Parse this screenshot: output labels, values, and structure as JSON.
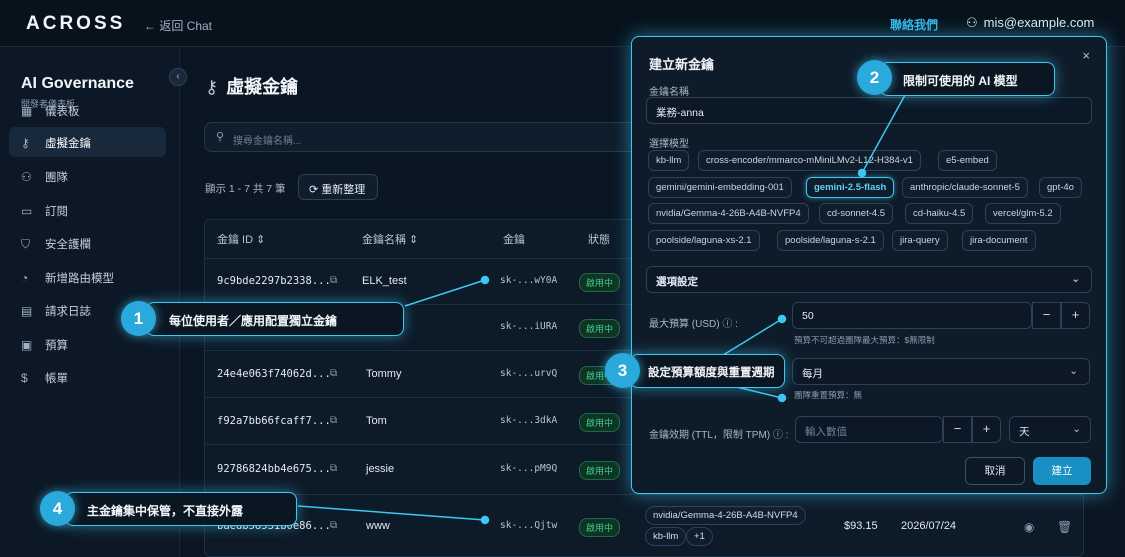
{
  "topbar": {
    "logo": "ACROSS",
    "back_label": "← 返回 Chat",
    "contact": "聯絡我們",
    "user_email": "mis@example.com"
  },
  "sidebar": {
    "title": "AI Governance",
    "subtitle": "開發者儀表板",
    "collapse_icon": "‹",
    "items": [
      {
        "icon": "dashboard-icon",
        "glyph": "▦",
        "label": "儀表板",
        "active": false
      },
      {
        "icon": "key-icon",
        "glyph": "⚷",
        "label": "虛擬金鑰",
        "active": true
      },
      {
        "icon": "team-icon",
        "glyph": "⚇",
        "label": "團隊",
        "active": false
      },
      {
        "icon": "subscription-icon",
        "glyph": "▭",
        "label": "訂閱",
        "active": false
      },
      {
        "icon": "shield-icon",
        "glyph": "⛉",
        "label": "安全護欄",
        "active": false
      },
      {
        "icon": "route-icon",
        "glyph": "◔",
        "label": "新增路由模型",
        "active": false
      },
      {
        "icon": "log-icon",
        "glyph": "▤",
        "label": "請求日誌",
        "active": false
      },
      {
        "icon": "budget-icon",
        "glyph": "▣",
        "label": "預算",
        "active": false
      },
      {
        "icon": "billing-icon",
        "glyph": "$",
        "label": "帳單",
        "active": false
      }
    ]
  },
  "main": {
    "title": "虛擬金鑰",
    "search_placeholder": "搜尋金鑰名稱...",
    "count_text": "顯示 1 - 7 共 7 筆",
    "refresh_label": "重新整理",
    "columns": [
      "金鑰 ID ⇕",
      "金鑰名稱 ⇕",
      "金鑰",
      "狀態"
    ],
    "rows": [
      {
        "id": "9c9bde2297b2338...",
        "name": "ELK_test",
        "key": "sk-...wY0A",
        "status": "啟用中"
      },
      {
        "id": "",
        "name": "",
        "key": "sk-...iURA",
        "status": "啟用中"
      },
      {
        "id": "24e4e063f74062d...",
        "name": "Tommy",
        "key": "sk-...urvQ",
        "status": "啟用中"
      },
      {
        "id": "f92a7bb66fcaff7...",
        "name": "Tom",
        "key": "sk-...3dkA",
        "status": "啟用中"
      },
      {
        "id": "92786824bb4e675...",
        "name": "jessie",
        "key": "sk-...pM9Q",
        "status": "啟用中"
      },
      {
        "id": "baedb58531b0e86...",
        "name": "www",
        "key": "sk-...Qjtw",
        "status": "啟用中",
        "models": [
          "nvidia/Gemma-4-26B-A4B-NVFP4",
          "kb-llm",
          "+1"
        ],
        "spend": "$93.15",
        "expiry": "2026/07/24"
      }
    ]
  },
  "modal": {
    "title": "建立新金鑰",
    "close": "×",
    "name_label": "金鑰名稱",
    "name_value": "業務-anna",
    "model_label": "選擇模型",
    "models": [
      {
        "label": "kb-llm",
        "selected": false
      },
      {
        "label": "cross-encoder/mmarco-mMiniLMv2-L12-H384-v1",
        "selected": false
      },
      {
        "label": "e5-embed",
        "selected": false
      },
      {
        "label": "gemini/gemini-embedding-001",
        "selected": false
      },
      {
        "label": "gemini-2.5-flash",
        "selected": true
      },
      {
        "label": "anthropic/claude-sonnet-5",
        "selected": false
      },
      {
        "label": "gpt-4o",
        "selected": false
      },
      {
        "label": "nvidia/Gemma-4-26B-A4B-NVFP4",
        "selected": false
      },
      {
        "label": "cd-sonnet-4.5",
        "selected": false
      },
      {
        "label": "cd-haiku-4.5",
        "selected": false
      },
      {
        "label": "vercel/glm-5.2",
        "selected": false
      },
      {
        "label": "poolside/laguna-xs-2.1",
        "selected": false
      },
      {
        "label": "poolside/laguna-s-2.1",
        "selected": false
      },
      {
        "label": "jira-query",
        "selected": false
      },
      {
        "label": "jira-document",
        "selected": false
      }
    ],
    "options_label": "選項設定",
    "budget_label": "最大預算 (USD)",
    "budget_value": "50",
    "budget_hint": "預算不可超過團隊最大預算：$無限制",
    "period_value": "每月",
    "period_hint": "團隊重置預算：無",
    "ttl_label": "金鑰效期 (TTL，限制 TPM)",
    "ttl_placeholder": "輸入數值",
    "ttl_unit": "天",
    "cancel": "取消",
    "create": "建立"
  },
  "callouts": [
    {
      "num": "1",
      "text": "每位使用者／應用配置獨立金鑰"
    },
    {
      "num": "2",
      "text": "限制可使用的 AI 模型"
    },
    {
      "num": "3",
      "text": "設定預算額度與重置週期"
    },
    {
      "num": "4",
      "text": "主金鑰集中保管，不直接外露"
    }
  ],
  "accent": "#3ec7f0"
}
